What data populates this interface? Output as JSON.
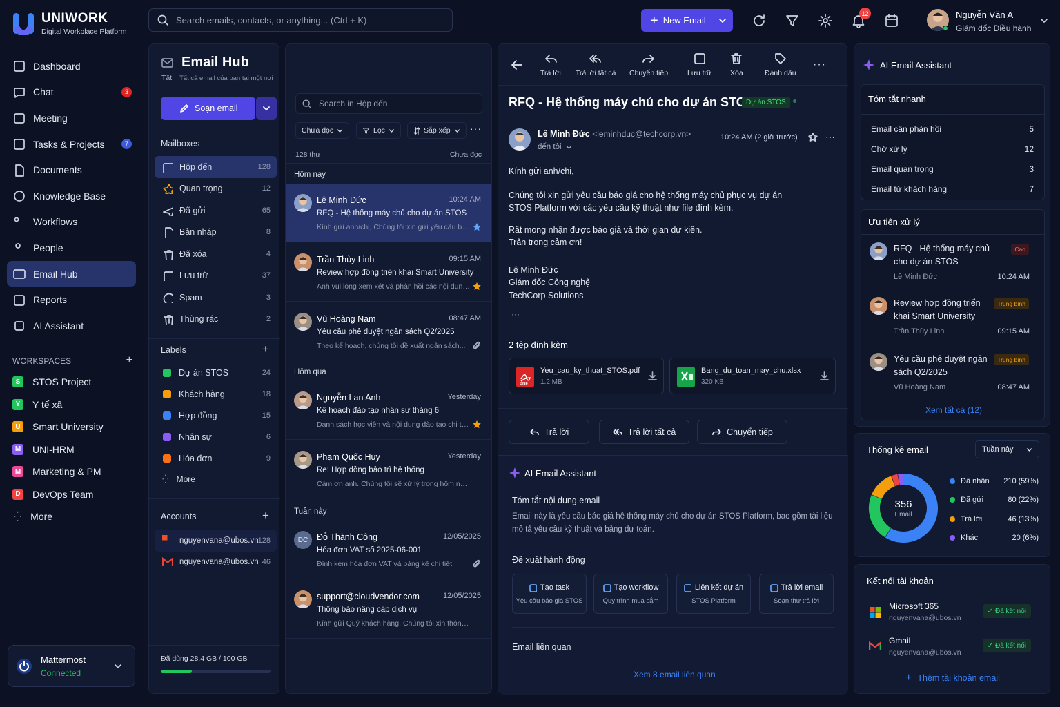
{
  "app": {
    "brand": "UNIWORK",
    "subtitle": "Digital Workplace Platform"
  },
  "sidebar": {
    "items": [
      {
        "label": "Dashboard",
        "icon": "dashboard-icon"
      },
      {
        "label": "Chat",
        "icon": "chat-icon",
        "badge": "3"
      },
      {
        "label": "Meeting",
        "icon": "calendar-icon"
      },
      {
        "label": "Tasks & Projects",
        "icon": "tasks-icon",
        "badge": "7"
      },
      {
        "label": "Documents",
        "icon": "document-icon"
      },
      {
        "label": "Knowledge Base",
        "icon": "knowledge-icon"
      },
      {
        "label": "Workflows",
        "icon": "workflow-icon"
      },
      {
        "label": "People",
        "icon": "people-icon"
      },
      {
        "label": "Email Hub",
        "icon": "mail-icon",
        "active": true
      },
      {
        "label": "Reports",
        "icon": "reports-icon"
      },
      {
        "label": "AI Assistant",
        "icon": "ai-icon"
      }
    ],
    "workspaces_title": "WORKSPACES",
    "workspaces": [
      {
        "letter": "S",
        "label": "STOS Project",
        "color": "#22c55e"
      },
      {
        "letter": "Y",
        "label": "Y tế xã",
        "color": "#22c55e"
      },
      {
        "letter": "U",
        "label": "Smart University",
        "color": "#f59e0b"
      },
      {
        "letter": "M",
        "label": "UNI-HRM",
        "color": "#8b5cf6"
      },
      {
        "letter": "M",
        "label": "Marketing & PM",
        "color": "#ec4899"
      },
      {
        "letter": "D",
        "label": "DevOps Team",
        "color": "#ef4444"
      }
    ],
    "more": "More",
    "mattermost": {
      "name": "Mattermost",
      "status": "Connected"
    }
  },
  "topbar": {
    "search_placeholder": "Search emails, contacts, or anything... (Ctrl + K)",
    "new_email": "New Email",
    "notif_count": "12",
    "user_name": "Nguyễn Văn A",
    "user_role": "Giám đốc Điều hành"
  },
  "hub": {
    "title": "Email Hub",
    "tab": "Tất",
    "subtitle": "Tất cả email của bạn tại một nơi",
    "compose": "Soạn email",
    "mailboxes_title": "Mailboxes",
    "mailboxes": [
      {
        "label": "Hộp đến",
        "count": "128",
        "icon": "inbox-icon"
      },
      {
        "label": "Quan trọng",
        "count": "12",
        "icon": "star-icon"
      },
      {
        "label": "Đã gửi",
        "count": "65",
        "icon": "sent-icon"
      },
      {
        "label": "Bản nháp",
        "count": "8",
        "icon": "draft-icon"
      },
      {
        "label": "Đã xóa",
        "count": "4",
        "icon": "trash-icon"
      },
      {
        "label": "Lưu trữ",
        "count": "37",
        "icon": "archive-icon"
      },
      {
        "label": "Spam",
        "count": "3",
        "icon": "spam-icon"
      },
      {
        "label": "Thùng rác",
        "count": "2",
        "icon": "bin-icon"
      }
    ],
    "labels_title": "Labels",
    "labels": [
      {
        "label": "Dự án STOS",
        "count": "24",
        "color": "#22c55e"
      },
      {
        "label": "Khách hàng",
        "count": "18",
        "color": "#f59e0b"
      },
      {
        "label": "Hợp đồng",
        "count": "15",
        "color": "#3b82f6"
      },
      {
        "label": "Nhân sự",
        "count": "6",
        "color": "#8b5cf6"
      },
      {
        "label": "Hóa đơn",
        "count": "9",
        "color": "#f97316"
      }
    ],
    "labels_more": "More",
    "accounts_title": "Accounts",
    "accounts": [
      {
        "email": "nguyenvana@ubos.vn",
        "count": "128",
        "icon": "microsoft-icon"
      },
      {
        "email": "nguyenvana@ubos.vn",
        "count": "46",
        "icon": "gmail-icon"
      }
    ],
    "storage": "Đã dùng 28.4 GB / 100 GB",
    "storage_fraction": 0.284
  },
  "list": {
    "search_placeholder": "Search in Hộp đến",
    "filter_unread": "Chưa đọc",
    "filter": "Lọc",
    "sort": "Sắp xếp",
    "total": "128 thư",
    "unread": "Chưa đọc",
    "groups": [
      "Hôm nay",
      "Hôm qua",
      "Tuần này"
    ],
    "emails": [
      {
        "from": "Lê Minh Đức",
        "time": "10:24 AM",
        "subject": "RFQ - Hệ thống máy chủ cho dự án STOS",
        "snippet": "Kính gửi anh/chị, Chúng tôi xin gửi yêu cầu báo giá...",
        "flag": "star-blue",
        "avatar": "#8aa0c8"
      },
      {
        "from": "Trần Thùy Linh",
        "time": "09:15 AM",
        "subject": "Review hợp đồng triển khai Smart University",
        "snippet": "Anh vui lòng xem xét và phản hồi các nội dung...",
        "flag": "star-yellow",
        "avatar": "#c9906a"
      },
      {
        "from": "Vũ Hoàng Nam",
        "time": "08:47 AM",
        "subject": "Yêu cầu phê duyệt ngân sách Q2/2025",
        "snippet": "Theo kế hoạch, chúng tôi đề xuất ngân sách...",
        "flag": "attach",
        "avatar": "#9a8f85"
      },
      {
        "from": "Nguyễn Lan Anh",
        "time": "Yesterday",
        "subject": "Kế hoạch đào tạo nhân sự tháng 6",
        "snippet": "Danh sách học viên và nội dung đào tạo chi tiết...",
        "flag": "star-yellow",
        "avatar": "#b89a8a"
      },
      {
        "from": "Phạm Quốc Huy",
        "time": "Yesterday",
        "subject": "Re: Hợp đồng bảo trì hệ thống",
        "snippet": "Cảm ơn anh. Chúng tôi sẽ xử lý trong hôm nay...",
        "flag": "",
        "avatar": "#a89888"
      },
      {
        "from": "Đỗ Thành Công",
        "time": "12/05/2025",
        "subject": "Hóa đơn VAT số 2025-06-001",
        "snippet": "Đính kèm hóa đơn VAT và bảng kê chi tiết.",
        "flag": "attach",
        "avatar": "#5b6b8f",
        "initials": "DC"
      },
      {
        "from": "support@cloudvendor.com",
        "time": "12/05/2025",
        "subject": "Thông báo nâng cấp dịch vụ",
        "snippet": "Kính gửi Quý khách hàng, Chúng tôi xin thông...",
        "flag": "",
        "avatar": "#c9906a"
      }
    ]
  },
  "reader": {
    "tools": [
      "Trả lời",
      "Trả lời tất cả",
      "Chuyển tiếp",
      "Lưu trữ",
      "Xóa",
      "Đánh dấu"
    ],
    "subject": "RFQ - Hệ thống máy chủ cho dự án STOS",
    "tag": "Dự án STOS",
    "sender_name": "Lê Minh Đức",
    "sender_email": "<leminhduc@techcorp.vn>",
    "to": "đến tôi",
    "time": "10:24 AM (2 giờ trước)",
    "greeting": "Kính gửi anh/chị,",
    "para1a": "Chúng tôi xin gửi yêu cầu báo giá cho hệ thống máy chủ phục vụ dự án",
    "para1b": "STOS Platform với các yêu cầu kỹ thuật như file đính kèm.",
    "para2a": "Rất mong nhận được báo giá và thời gian dự kiến.",
    "para2b": "Trân trọng cảm ơn!",
    "sig_name": "Lê Minh Đức",
    "sig_role": "Giám đốc Công nghệ",
    "sig_company": "TechCorp Solutions",
    "attach_title": "2 tệp đính kèm",
    "attachments": [
      {
        "name": "Yeu_cau_ky_thuat_STOS.pdf",
        "size": "1.2 MB"
      },
      {
        "name": "Bang_du_toan_may_chu.xlsx",
        "size": "320 KB"
      }
    ],
    "reply": "Trả lời",
    "reply_all": "Trả lời tất cả",
    "forward": "Chuyển tiếp",
    "ai_title": "AI Email Assistant",
    "summary_title": "Tóm tắt nội dung email",
    "summary_a": "Email này là yêu cầu báo giá hệ thống máy chủ cho dự án STOS Platform, bao gồm tài liệu",
    "summary_b": "mô tả yêu cầu kỹ thuật và bảng dự toán.",
    "actions_title": "Đề xuất hành động",
    "suggestions": [
      {
        "title": "Tạo task",
        "sub": "Yêu cầu báo giá STOS"
      },
      {
        "title": "Tạo workflow",
        "sub": "Quy trình mua sắm"
      },
      {
        "title": "Liên kết dự án",
        "sub": "STOS Platform"
      },
      {
        "title": "Trả lời email",
        "sub": "Soạn thư trả lời"
      }
    ],
    "related_title": "Email liên quan",
    "related_link": "Xem 8 email liên quan"
  },
  "right": {
    "title": "AI Email Assistant",
    "quick_title": "Tóm tắt nhanh",
    "quick": [
      {
        "label": "Email cần phản hồi",
        "value": "5"
      },
      {
        "label": "Chờ xử lý",
        "value": "12"
      },
      {
        "label": "Email quan trọng",
        "value": "3"
      },
      {
        "label": "Email từ khách hàng",
        "value": "7"
      }
    ],
    "priority_title": "Ưu tiên xử lý",
    "priority": [
      {
        "title": "RFQ - Hệ thống máy chủ cho dự án STOS",
        "name": "Lê Minh Đức",
        "time": "10:24 AM",
        "tag": "Cao",
        "tag_color": "#f87171",
        "tag_bg": "#3b1820",
        "avatar": "#8aa0c8"
      },
      {
        "title": "Review hợp đồng triển khai Smart University",
        "name": "Trần Thùy Linh",
        "time": "09:15 AM",
        "tag": "Trung bình",
        "tag_color": "#f59e0b",
        "tag_bg": "#3a2a12",
        "avatar": "#c9906a"
      },
      {
        "title": "Yêu cầu phê duyệt ngân sách Q2/2025",
        "name": "Vũ Hoàng Nam",
        "time": "08:47 AM",
        "tag": "Trung bình",
        "tag_color": "#f59e0b",
        "tag_bg": "#3a2a12",
        "avatar": "#9a8f85"
      }
    ],
    "see_all": "Xem tất cả (12)",
    "stats_title": "Thống kê email",
    "stats_period": "Tuần này",
    "stats_total": "356",
    "stats_unit": "Email",
    "connect_title": "Kết nối tài khoản",
    "connections": [
      {
        "name": "Microsoft 365",
        "email": "nguyenvana@ubos.vn",
        "status": "Đã kết nối"
      },
      {
        "name": "Gmail",
        "email": "nguyenvana@ubos.vn",
        "status": "Đã kết nối"
      }
    ],
    "add_account": "Thêm tài khoản email"
  },
  "chart_data": {
    "type": "pie",
    "categories": [
      "Đã nhận",
      "Đã gửi",
      "Trả lời",
      "Khác"
    ],
    "values": [
      210,
      80,
      46,
      20
    ],
    "value_labels": [
      "210 (59%)",
      "80 (22%)",
      "46 (13%)",
      "20 (6%)"
    ],
    "colors": [
      "#3b82f6",
      "#22c55e",
      "#f59e0b",
      "#8b5cf6"
    ],
    "extra_color": "#ef4444",
    "legend": "right"
  }
}
